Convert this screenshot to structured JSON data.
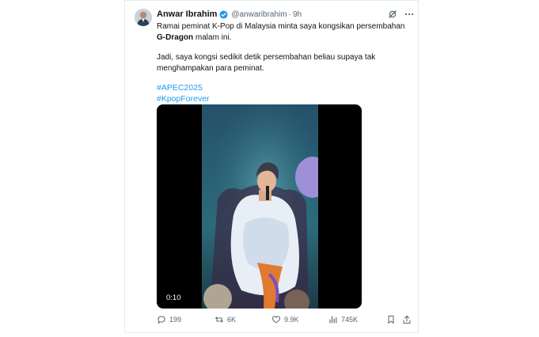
{
  "tweet": {
    "author_name": "Anwar Ibrahim",
    "handle": "@anwaribrahim",
    "separator": "·",
    "time": "9h",
    "line1_part1": "Ramai peminat K-Pop di Malaysia minta saya kongsikan persembahan ",
    "line1_bold": "G-Dragon",
    "line1_part2": " malam ini.",
    "line2": "Jadi, saya kongsi sedikit detik persembahan beliau supaya tak menghampakan para peminat.",
    "hashtags": [
      "#APEC2025",
      "#KpopForever"
    ]
  },
  "video": {
    "timestamp": "0:10"
  },
  "actions": {
    "replies": "199",
    "reposts": "6K",
    "likes": "9.9K",
    "views": "745K"
  },
  "icons": {
    "verified": "verified-badge-icon",
    "grok": "grok-icon",
    "more": "more-icon",
    "reply": "reply-icon",
    "repost": "repost-icon",
    "like": "heart-icon",
    "views": "views-icon",
    "bookmark": "bookmark-icon",
    "share": "share-icon"
  },
  "colors": {
    "link": "#1d9bf0",
    "verified": "#1d9bf0",
    "muted_text": "#536471",
    "video_background": "#000000"
  }
}
